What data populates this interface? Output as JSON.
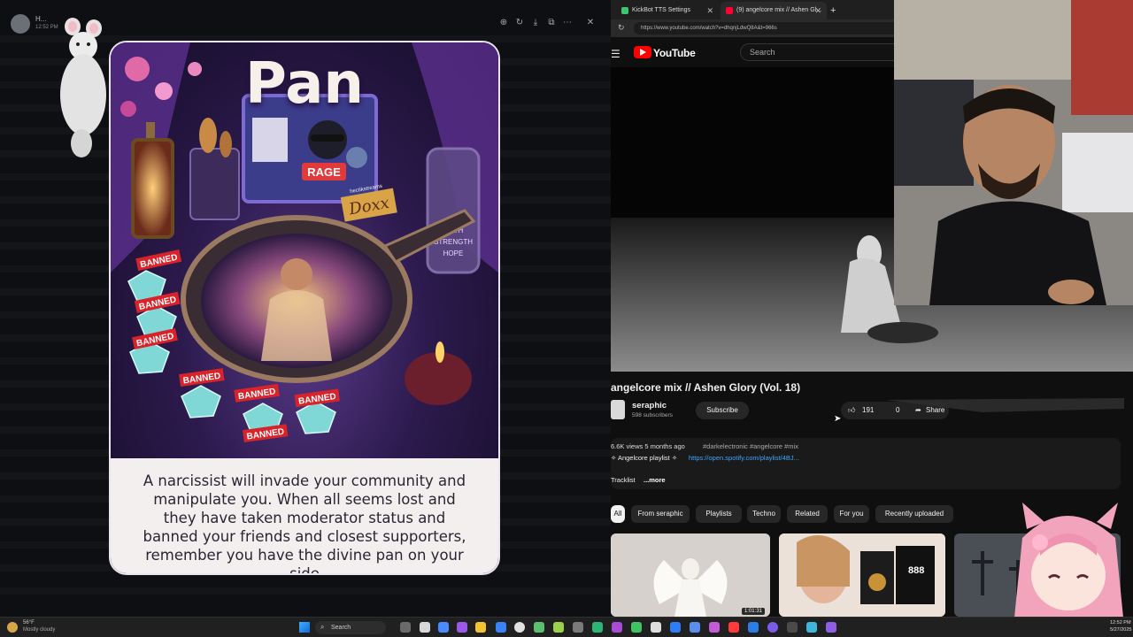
{
  "viewer": {
    "user_name": "H...",
    "time": "12:52 PM",
    "tools": [
      "zoom-in-icon",
      "rotate-icon",
      "download-icon",
      "open-external-icon",
      "more-icon"
    ],
    "close_glyph": "✕"
  },
  "card": {
    "title": "Pan",
    "badge_rage": "RAGE",
    "badge_doxx": "Doxx",
    "badge_sticker": "hectikstreams",
    "jar_text": [
      "FAITH",
      "STRENGTH",
      "HOPE"
    ],
    "banned_label": "BANNED",
    "text": "A narcissist will invade your community and manipulate you. When all seems lost and they have taken moderator status and banned your friends and closest supporters, remember you have the divine pan on your side"
  },
  "browser": {
    "tabs": [
      {
        "label": "KickBot TTS Settings",
        "color": "#3ec46d",
        "active": false
      },
      {
        "label": "(9) angelcore mix // Ashen Gl...",
        "color": "#ff0033",
        "active": true
      }
    ],
    "new_tab": "+",
    "url": "https://www.youtube.com/watch?v=dhqnjLdwQ8A&t=966s",
    "youtube": {
      "brand": "YouTube",
      "search_placeholder": "Search",
      "video_title": "angelcore mix // Ashen Glory (Vol. 18)",
      "channel": "seraphic",
      "subscribers": "598 subscribers",
      "subscribe_label": "Subscribe",
      "likes": "191",
      "dislikes": "0",
      "share_label": "Share",
      "views_age": "6.6K views  5 months ago",
      "hashtags": "#darkelectronic #angelcore #mix",
      "playlist_label": "✧ Angelcore playlist ✧",
      "playlist_link": "https://open.spotify.com/playlist/4BJ...",
      "tracklist_label": "Tracklist",
      "more_label": "...more",
      "chips": [
        "All",
        "From seraphic",
        "Playlists",
        "Techno",
        "Related",
        "For you",
        "Recently uploaded"
      ],
      "thumb_duration": "1:01:31",
      "thumb_888": "888"
    }
  },
  "taskbar": {
    "weather_temp": "56°F",
    "weather_desc": "Mostly cloudy",
    "search_placeholder": "Search",
    "clock_time": "12:52 PM",
    "clock_date": "5/27/2025"
  },
  "colors": {
    "youtube_red": "#ff0000",
    "link_blue": "#3ea6ff",
    "banned_red": "#d8232a",
    "card_cream": "#f2efee"
  }
}
